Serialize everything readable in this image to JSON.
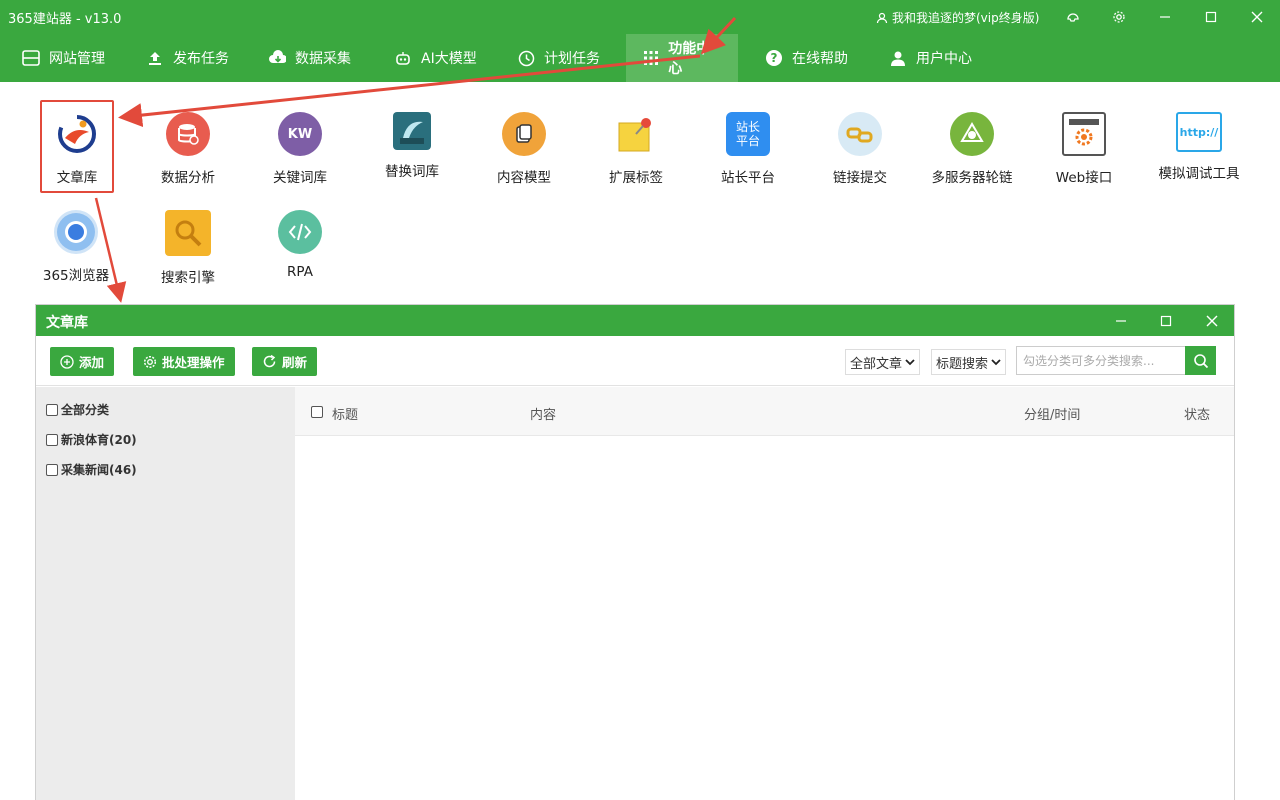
{
  "app": {
    "title": "365建站器 - v13.0",
    "user": "我和我追逐的梦(vip终身版)"
  },
  "nav": [
    {
      "label": "网站管理",
      "icon": "window-icon"
    },
    {
      "label": "发布任务",
      "icon": "upload-icon"
    },
    {
      "label": "数据采集",
      "icon": "cloud-download-icon"
    },
    {
      "label": "AI大模型",
      "icon": "robot-icon"
    },
    {
      "label": "计划任务",
      "icon": "clock-icon"
    },
    {
      "label": "功能中心",
      "icon": "grid-icon"
    },
    {
      "label": "在线帮助",
      "icon": "help-icon"
    },
    {
      "label": "用户中心",
      "icon": "user-icon"
    }
  ],
  "tools": [
    {
      "label": "文章库",
      "color": "#ffffff"
    },
    {
      "label": "数据分析",
      "color": "#e85c4f"
    },
    {
      "label": "关键词库",
      "color": "#7e5ea6",
      "text": "KW"
    },
    {
      "label": "替换词库",
      "color": "#2a6f7d"
    },
    {
      "label": "内容模型",
      "color": "#f0a33a"
    },
    {
      "label": "扩展标签",
      "color": "#f6d33f"
    },
    {
      "label": "站长平台",
      "color": "#2f8ef0",
      "text": "站长\n平台"
    },
    {
      "label": "链接提交",
      "color": "#f0c030"
    },
    {
      "label": "多服务器轮链",
      "color": "#78b53d"
    },
    {
      "label": "Web接口",
      "color": "#555555"
    },
    {
      "label": "模拟调试工具",
      "color": "#2aa7e8",
      "text": "http://"
    },
    {
      "label": "365浏览器",
      "color": "#3a7de0"
    },
    {
      "label": "搜索引擎",
      "color": "#f4b42a"
    },
    {
      "label": "RPA",
      "color": "#5bbf9f"
    }
  ],
  "window": {
    "title": "文章库",
    "buttons": {
      "add": "添加",
      "batch": "批处理操作",
      "refresh": "刷新"
    },
    "filter_select": "全部文章",
    "search_select": "标题搜索",
    "search_placeholder": "勾选分类可多分类搜索...",
    "categories": [
      "全部分类",
      "新浪体育(20)",
      "采集新闻(46)"
    ],
    "columns": {
      "title": "标题",
      "content": "内容",
      "group_time": "分组/时间",
      "status": "状态"
    }
  }
}
